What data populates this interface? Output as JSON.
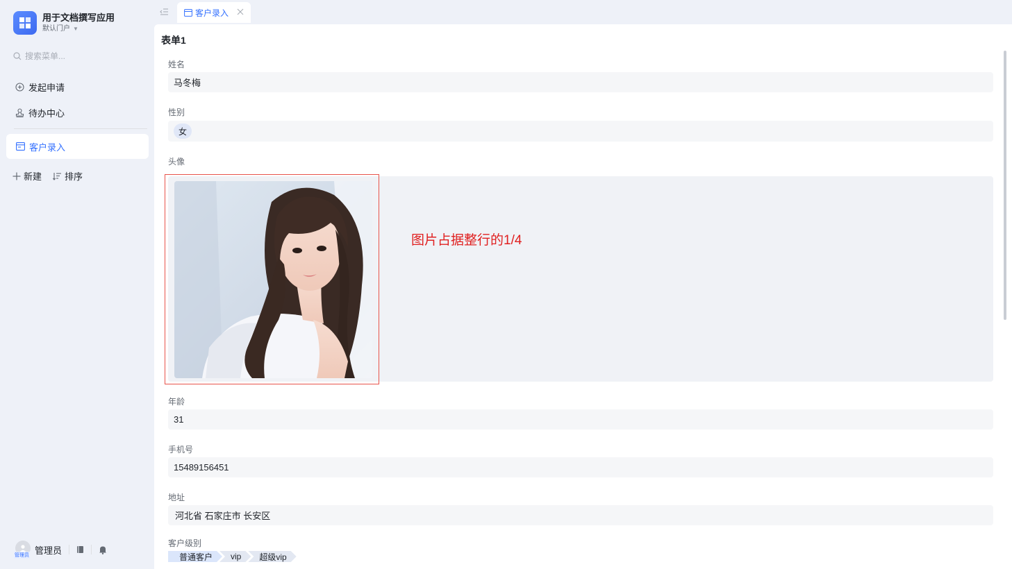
{
  "app": {
    "title": "用于文档撰写应用",
    "portal": "默认门户"
  },
  "sidebar": {
    "search_placeholder": "搜索菜单...",
    "items": [
      {
        "label": "发起申请",
        "icon": "plus-circle-icon"
      },
      {
        "label": "待办中心",
        "icon": "stamp-icon"
      }
    ],
    "active_item": {
      "label": "客户录入",
      "icon": "form-icon"
    },
    "new_label": "新建",
    "sort_label": "排序",
    "user": {
      "name": "管理员",
      "role_tag": "管理员"
    }
  },
  "tabs": [
    {
      "label": "客户录入"
    }
  ],
  "form": {
    "title": "表单1",
    "fields": {
      "name": {
        "label": "姓名",
        "value": "马冬梅"
      },
      "gender": {
        "label": "性别",
        "value": "女"
      },
      "avatar": {
        "label": "头像"
      },
      "age": {
        "label": "年龄",
        "value": "31"
      },
      "phone": {
        "label": "手机号",
        "value": "15489156451"
      },
      "address": {
        "label": "地址",
        "value": "河北省 石家庄市 长安区"
      },
      "level": {
        "label": "客户级别",
        "options": [
          "普通客户",
          "vip",
          "超级vip"
        ]
      }
    }
  },
  "annotation": "图片占据整行的1/4",
  "colors": {
    "accent": "#3370ff",
    "annotation_red": "#e02020",
    "field_bg": "#f5f6f8"
  }
}
